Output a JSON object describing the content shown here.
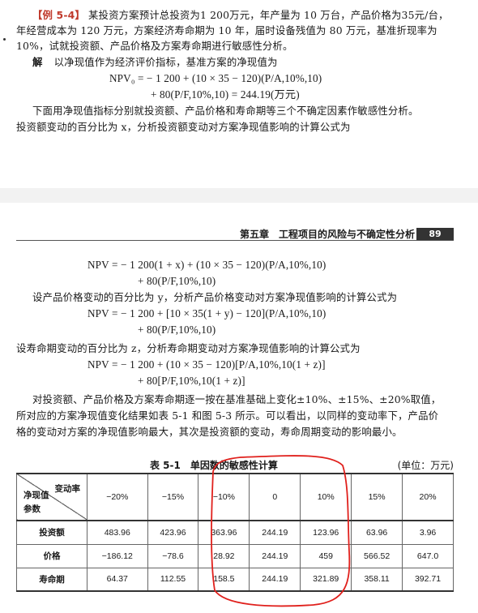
{
  "top": {
    "example_tag": "【例 5-4】",
    "p1_rest": "某投资方案预计总投资为1 200万元，年产量为 10 万台，产品价格为35元/台，",
    "p2": "年经营成本为 120 万元，方案经济寿命期为 10 年，届时设备残值为 80 万元，基准折现率为",
    "p3": "10%，试就投资额、产品价格及方案寿命期进行敏感性分析。",
    "sol_label": "解",
    "sol_text": "以净现值作为经济评价指标，基准方案的净现值为",
    "f0a": "NPV₀ = − 1 200 + (10 × 35 − 120)(P/A,10%,10)",
    "f0b": "+ 80(P/F,10%,10) = 244.19(万元)",
    "p4": "下面用净现值指标分别就投资额、产品价格和寿命期等三个不确定因素作敏感性分析。",
    "p5": "投资额变动的百分比为 x，分析投资额变动对方案净现值影响的计算公式为"
  },
  "header": {
    "chapter": "第五章　工程项目的风险与不确定性分析",
    "page": "89"
  },
  "bottom": {
    "f1a": "NPV = − 1 200(1 + x) + (10 × 35 − 120)(P/A,10%,10)",
    "f1b": "+ 80(P/F,10%,10)",
    "p6": "设产品价格变动的百分比为 y，分析产品价格变动对方案净现值影响的计算公式为",
    "f2a": "NPV = − 1 200 + [10 × 35(1 + y) − 120](P/A,10%,10)",
    "f2b": "+ 80(P/F,10%,10)",
    "p7": "设寿命期变动的百分比为 z，分析寿命期变动对方案净现值影响的计算公式为",
    "f3a": "NPV = − 1 200 + (10 × 35 − 120)[P/A,10%,10(1 + z)]",
    "f3b": "+ 80[P/F,10%,10(1 + z)]",
    "p8": "对投资额、产品价格及方案寿命期逐一按在基准基础上变化±10%、±15%、±20%取值，",
    "p9": "所对应的方案净现值变化结果如表 5-1 和图 5-3 所示。可以看出，以同样的变动率下，产品价",
    "p10": "格的变动对方案的净现值影响最大，其次是投资额的变动，寿命周期变动的影响最小。"
  },
  "table": {
    "caption": "表 5-1　单因数的敏感性计算",
    "unit": "(单位：万元)",
    "corner_top": "变动率",
    "corner_mid": "净现值",
    "corner_bot": "参数",
    "headers": [
      "−20%",
      "−15%",
      "−10%",
      "0",
      "10%",
      "15%",
      "20%"
    ],
    "rows": [
      {
        "label": "投资额",
        "values": [
          "483.96",
          "423.96",
          "363.96",
          "244.19",
          "123.96",
          "63.96",
          "3.96"
        ]
      },
      {
        "label": "价格",
        "values": [
          "−186.12",
          "−78.6",
          "28.92",
          "244.19",
          "459",
          "566.52",
          "647.0"
        ]
      },
      {
        "label": "寿命期",
        "values": [
          "64.37",
          "112.55",
          "158.5",
          "244.19",
          "321.89",
          "358.11",
          "392.71"
        ]
      }
    ]
  },
  "colors": {
    "annotation": "#e0201c",
    "example_tag": "#c0392b",
    "page_badge": "#333333"
  }
}
